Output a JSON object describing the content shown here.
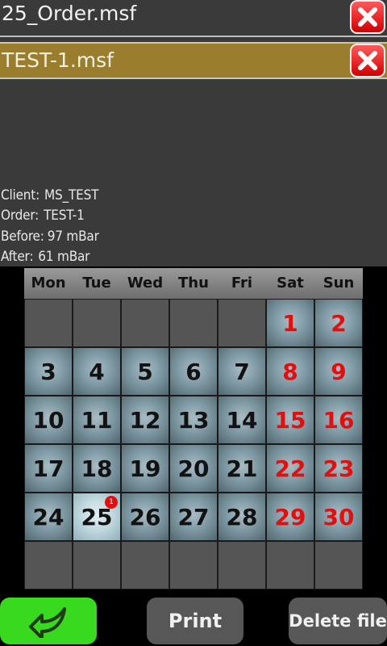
{
  "files": [
    {
      "name": "25_Order.msf",
      "selected": false
    },
    {
      "name": "TEST-1.msf",
      "selected": true
    }
  ],
  "info": {
    "client_label": "Client:",
    "client_value": "MS_TEST",
    "order_label": "Order:",
    "order_value": "TEST-1",
    "before_label": "Before:",
    "before_value": "97 mBar",
    "after_label": "After:",
    "after_value": "61 mBar"
  },
  "calendar": {
    "weekdays": [
      "Mon",
      "Tue",
      "Wed",
      "Thu",
      "Fri",
      "Sat",
      "Sun"
    ],
    "leading_blank_days": 5,
    "days_in_month": 30,
    "total_cells": 42,
    "today": 25,
    "badges": {
      "25": "1"
    }
  },
  "buttons": {
    "back_icon": "back-arrow-icon",
    "print": "Print",
    "delete": "Delete file"
  },
  "colors": {
    "selected_row": "#9a7e2e",
    "close_button": "#e00000",
    "weekend_text": "#e01010",
    "back_button": "#38d91e",
    "button_gray": "#575757"
  }
}
